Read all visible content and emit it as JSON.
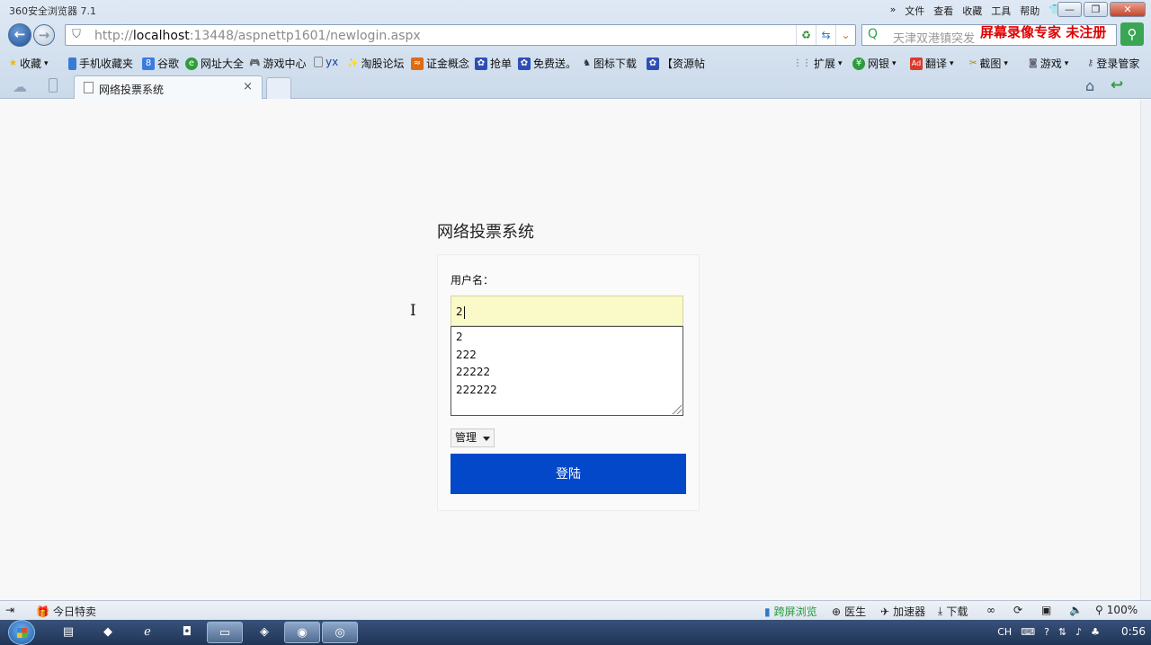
{
  "window": {
    "app_title": "360安全浏览器 7.1",
    "menu": [
      "»",
      "文件",
      "查看",
      "收藏",
      "工具",
      "帮助"
    ],
    "controls": [
      "—",
      "❐",
      "✕"
    ]
  },
  "navigation": {
    "url_prefix": "http://",
    "url_host": "localhost",
    "url_rest": ":13448/aspnettp1601/newlogin.aspx",
    "search_placeholder": "天津双港镇突发",
    "watermark": "屏幕录像专家  未注册"
  },
  "favorites": [
    {
      "label": "收藏",
      "icon": "star-icon",
      "color": "#f1b400"
    },
    {
      "label": "手机收藏夹",
      "icon": "phone-icon",
      "color": "#3a7bd5"
    },
    {
      "label": "谷歌",
      "icon": "google-icon",
      "color": "#3b7be0"
    },
    {
      "label": "网址大全",
      "icon": "globe-icon",
      "color": "#2e9c3a"
    },
    {
      "label": "游戏中心",
      "icon": "gamepad-icon",
      "color": "#666666"
    },
    {
      "label": "yx",
      "icon": "page-icon",
      "color": "#888888"
    },
    {
      "label": "淘股论坛",
      "icon": "sparkle-icon",
      "color": "#d08a00"
    },
    {
      "label": "证金概念",
      "icon": "flame-icon",
      "color": "#e06a10"
    },
    {
      "label": "抢单",
      "icon": "paw-icon",
      "color": "#2d4fb5"
    },
    {
      "label": "免费送。",
      "icon": "paw-icon",
      "color": "#2d4fb5"
    },
    {
      "label": "图标下载",
      "icon": "figure-icon",
      "color": "#333333"
    },
    {
      "label": "【资源帖",
      "icon": "paw-icon",
      "color": "#2d4fb5"
    }
  ],
  "toolbar_right": [
    "扩展",
    "网银",
    "翻译",
    "截图",
    "游戏",
    "登录管家"
  ],
  "tab": {
    "title": "网络投票系统",
    "close": "×"
  },
  "page": {
    "heading": "网络投票系统",
    "username_label": "用户名：",
    "username_value": "2",
    "suggestions": [
      "2",
      "222",
      "22222",
      "222222"
    ],
    "role_selected": "管理",
    "login_button": "登陆"
  },
  "statusbar": {
    "left": "今日特卖",
    "items": [
      "跨屏浏览",
      "医生",
      "加速器",
      "下载"
    ],
    "zoom": "100%"
  },
  "taskbar": {
    "lang": "CH",
    "clock": "0:56"
  }
}
